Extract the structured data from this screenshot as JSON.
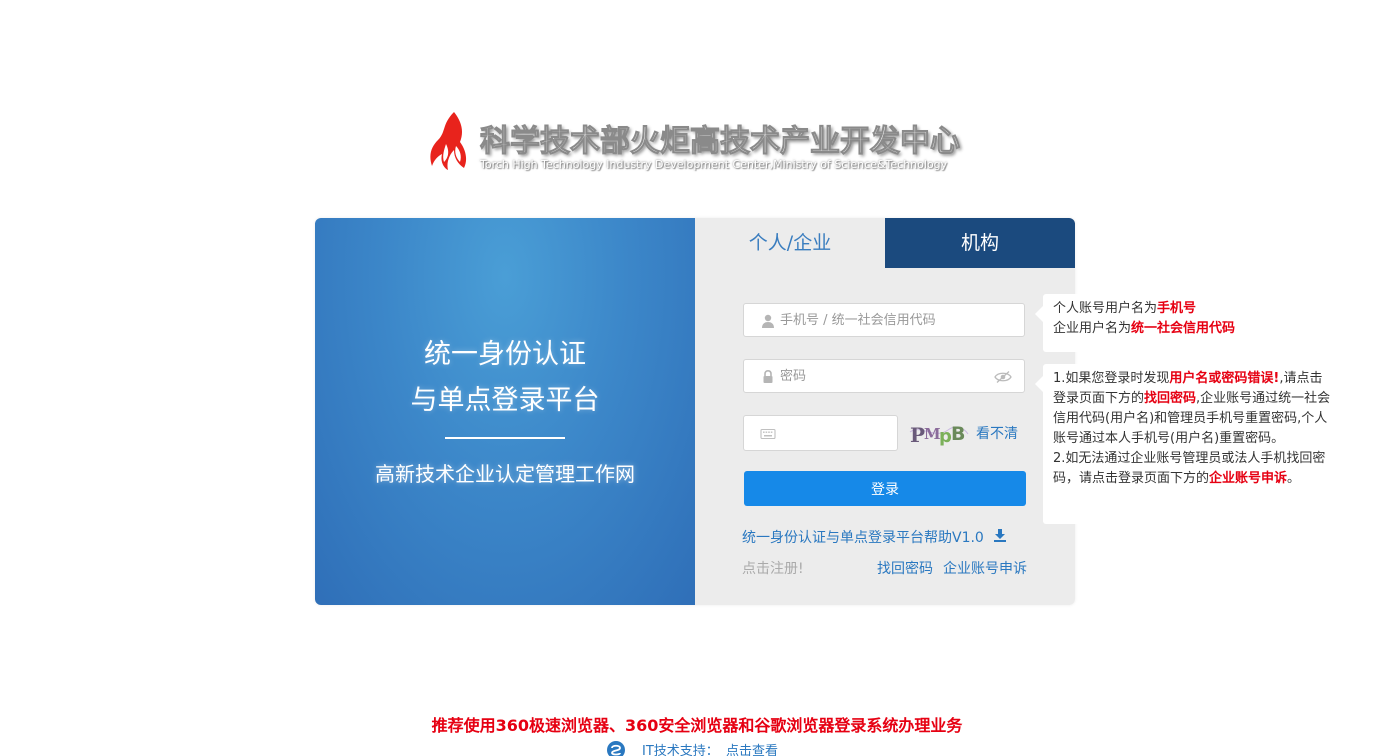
{
  "logo": {
    "title": "科学技术部火炬高技术产业开发中心",
    "subtitle": "Torch High Technology Industry Development Center,Ministry of Science&Technology"
  },
  "left_panel": {
    "title_line1": "统一身份认证",
    "title_line2": "与单点登录平台",
    "network_name": "高新技术企业认定管理工作网"
  },
  "tabs": [
    {
      "label": "个人/企业"
    },
    {
      "label": "机构"
    }
  ],
  "form": {
    "username_placeholder": "手机号 / 统一社会信用代码",
    "password_placeholder": "密码",
    "captcha_placeholder": "",
    "captcha_text": "PMpB",
    "refresh_label": "看不清",
    "login_label": "登录",
    "help_label": "统一身份认证与单点登录平台帮助V1.0",
    "register_label": "点击注册!",
    "recover_label": "找回密码",
    "appeal_label": "企业账号申诉"
  },
  "tip1": {
    "line1_prefix": "个人账号用户名为",
    "line1_highlight": "手机号",
    "line2_prefix": "企业用户名为",
    "line2_highlight": "统一社会信用代码"
  },
  "tip2": {
    "p1_a": "1.如果您登录时发现",
    "p1_b": "用户名或密码错误!",
    "p1_c": ",请点击登录页面下方的",
    "p1_d": "找回密码",
    "p1_e": ",企业账号通过统一社会信用代码(用户名)和管理员手机号重置密码,个人账号通过本人手机号(用户名)重置密码。",
    "p2_a": "2.如无法通过企业账号管理员或法人手机找回密码，请点击登录页面下方的",
    "p2_b": "企业账号申诉",
    "p2_c": "。"
  },
  "footer": {
    "notice": "推荐使用360极速浏览器、360安全浏览器和谷歌浏览器登录系统办理业务",
    "support_label": "IT技术支持：",
    "support_link": "点击查看"
  },
  "colors": {
    "brand_blue": "#1689e8",
    "tab_dark": "#1b4a7e",
    "alert_red": "#e60012",
    "link_blue": "#2a78c0"
  }
}
